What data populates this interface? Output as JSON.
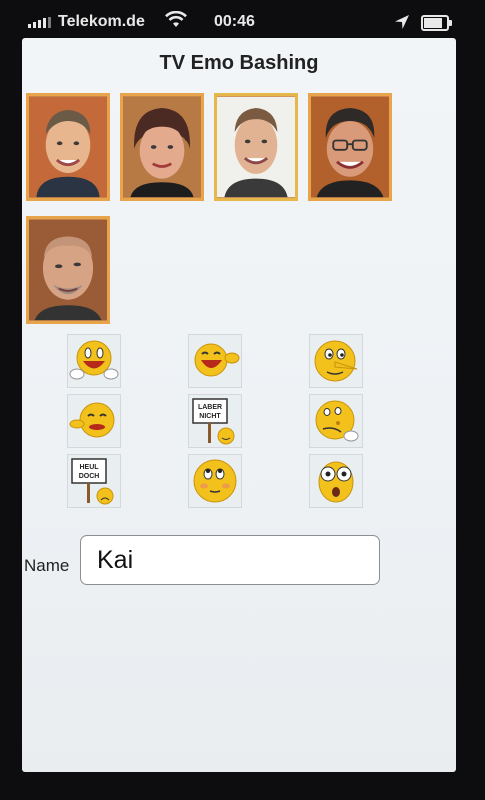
{
  "status_bar": {
    "carrier": "Telekom.de",
    "time": "00:46",
    "battery_level": 0.9
  },
  "app": {
    "title": "TV Emo Bashing"
  },
  "people": [
    {
      "icon": "person-portrait-1",
      "selected": false
    },
    {
      "icon": "person-portrait-2",
      "selected": false
    },
    {
      "icon": "person-portrait-3",
      "selected": true
    },
    {
      "icon": "person-portrait-4",
      "selected": false
    },
    {
      "icon": "person-portrait-5",
      "selected": false
    }
  ],
  "emoticons": [
    {
      "icon": "peeking-smiley-icon"
    },
    {
      "icon": "laughing-pointing-smiley-icon"
    },
    {
      "icon": "long-nose-smiley-icon"
    },
    {
      "icon": "talking-smiley-icon"
    },
    {
      "icon": "sign-smiley-icon",
      "sign_lines": [
        "LABER",
        "NICHT"
      ]
    },
    {
      "icon": "rolling-eyes-smiley-icon"
    },
    {
      "icon": "sign-smiley-icon",
      "sign_lines": [
        "HEUL",
        "DOCH"
      ]
    },
    {
      "icon": "dreamy-smiley-icon"
    },
    {
      "icon": "shocked-smiley-icon"
    }
  ],
  "form": {
    "name_label": "Name",
    "name_value": "Kai"
  }
}
